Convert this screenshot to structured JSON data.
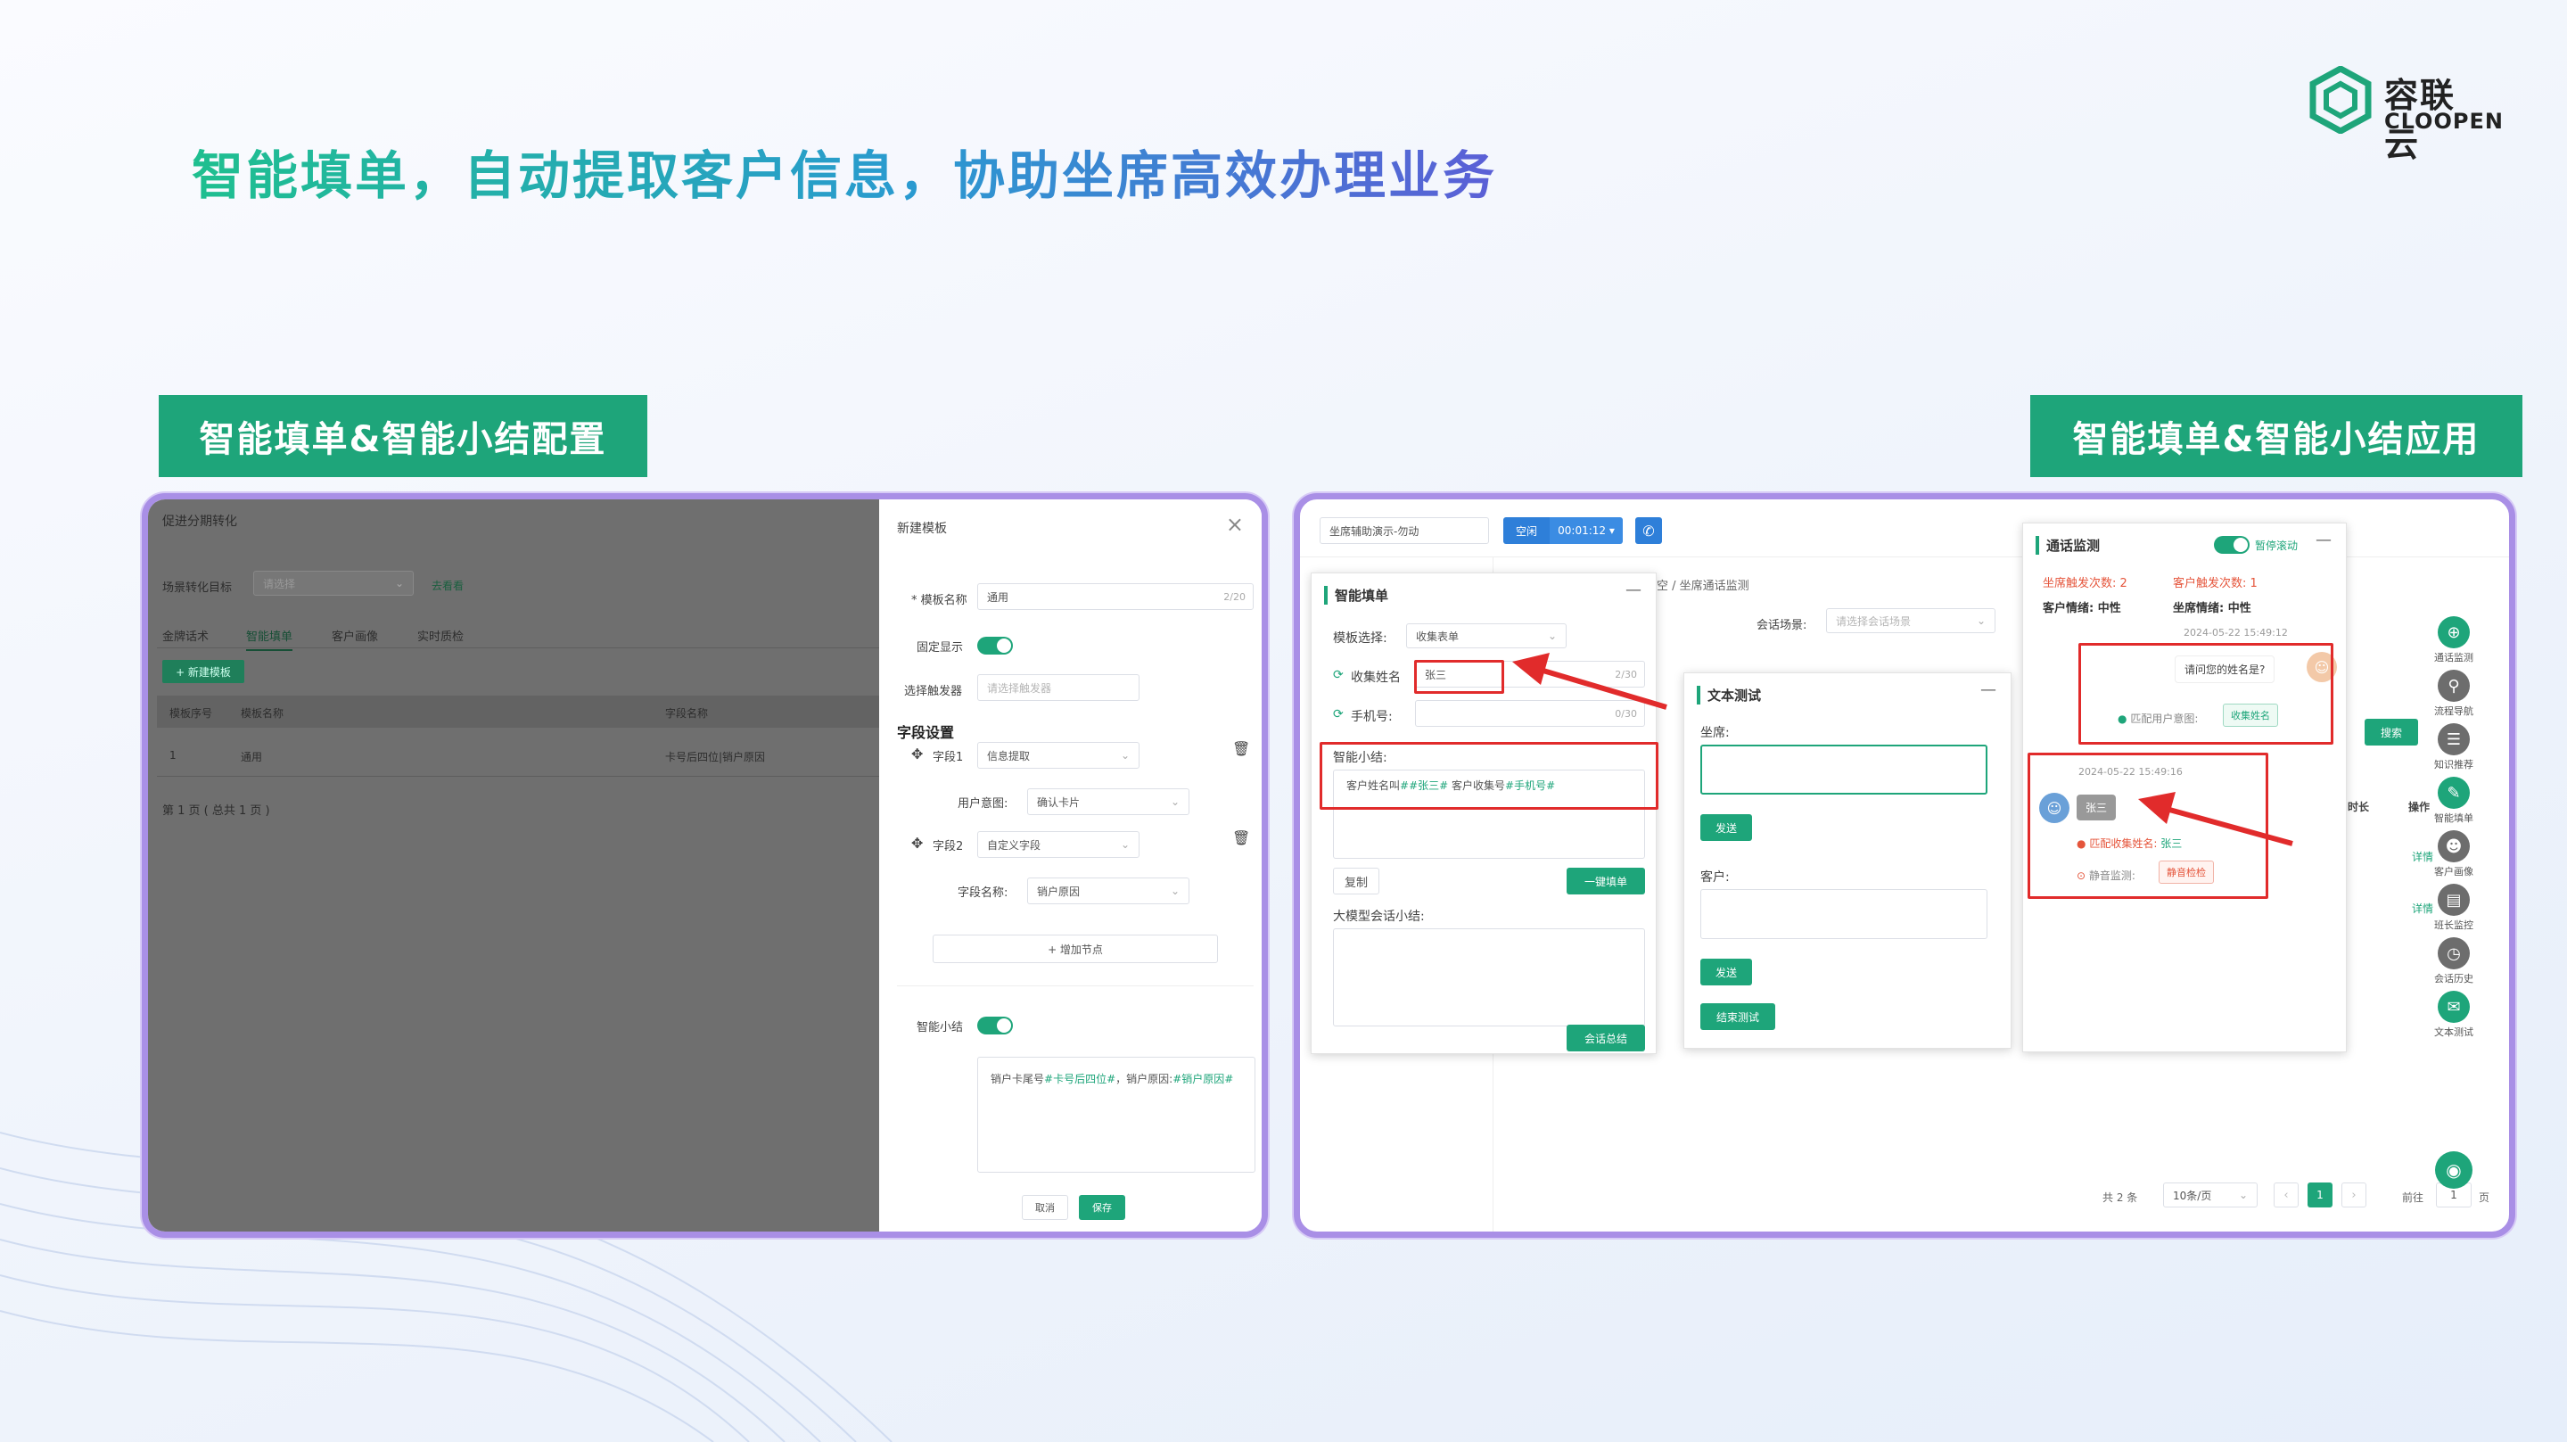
{
  "logo": {
    "cn": "容联云",
    "en": "CLOOPEN"
  },
  "title": "智能填单，自动提取客户信息，协助坐席高效办理业务",
  "tags": {
    "left": "智能填单&智能小结配置",
    "right": "智能填单&智能小结应用"
  },
  "left": {
    "bg": {
      "breadcrumb": "促进分期转化",
      "scene_label": "场景转化目标",
      "scene_placeholder": "请选择",
      "go_link": "去看看",
      "tabs": [
        "金牌话术",
        "智能填单",
        "客户画像",
        "实时质检"
      ],
      "new_btn": "+ 新建模板",
      "table_headers": [
        "模板序号",
        "模板名称",
        "字段名称"
      ],
      "row": [
        "1",
        "通用",
        "卡号后四位|销户原因"
      ],
      "pager": "第 1 页 ( 总共 1 页 )"
    },
    "drawer": {
      "title": "新建模板",
      "close": "×",
      "name_label": "* 模板名称",
      "name_value": "通用",
      "name_count": "2/20",
      "fixed_label": "固定显示",
      "trigger_label": "选择触发器",
      "trigger_placeholder": "请选择触发器",
      "section": "字段设置",
      "f1_label": "字段1",
      "f1_value": "信息提取",
      "intent_label": "用户意图:",
      "intent_value": "确认卡片",
      "f2_label": "字段2",
      "f2_value": "自定义字段",
      "fname_label": "字段名称:",
      "fname_value": "销户原因",
      "add_node": "+ 增加节点",
      "summary_label": "智能小结",
      "summary_text_a": "销户卡尾号",
      "summary_var1": "#卡号后四位#",
      "summary_text_b": "，销户原因:",
      "summary_var2": "#销户原因#",
      "cancel": "取消",
      "save": "保存"
    }
  },
  "right": {
    "topbar": {
      "select": "坐席辅助演示-勿动",
      "status": "空闲",
      "timer": "00:01:12 ▾",
      "crumb": "空 / 坐席通话监测",
      "session_label": "会话场景:",
      "session_ph": "请选择会话场景",
      "search": "搜索",
      "col_dur": "时长",
      "col_op": "操作",
      "detail1": "详情",
      "detail2": "详情",
      "pager_total": "共 2 条",
      "pager_size": "10条/页",
      "pager_page": "1",
      "pager_goto": "前往",
      "pager_goto_val": "1",
      "pager_unit": "页"
    },
    "fill": {
      "title": "智能填单",
      "min": "—",
      "tpl_label": "模板选择:",
      "tpl_value": "收集表单",
      "name_label": "收集姓名",
      "name_value": "张三",
      "name_count": "2/30",
      "phone_label": "手机号:",
      "phone_count": "0/30",
      "summary_label": "智能小结:",
      "summary_a": "客户姓名叫",
      "summary_v1": "##张三#",
      "summary_b": " 客户收集号",
      "summary_v2": "#手机号#",
      "copy": "复制",
      "one_click": "一键填单",
      "llm_label": "大模型会话小结:",
      "session_sum": "会话总结"
    },
    "test": {
      "title": "文本测试",
      "min": "—",
      "agent_label": "坐席:",
      "send1": "发送",
      "cust_label": "客户:",
      "send2": "发送",
      "end": "结束测试"
    },
    "monitor": {
      "title": "通话监测",
      "toggle_label": "暂停滚动",
      "min": "—",
      "agent_trig": "坐席触发次数: 2",
      "cust_trig": "客户触发次数: 1",
      "cust_mood": "客户情绪: 中性",
      "agent_mood": "坐席情绪: 中性",
      "ts1": "2024-05-22 15:49:12",
      "q": "请问您的姓名是?",
      "intent_label": "匹配用户意图:",
      "intent_tag": "收集姓名",
      "ts2": "2024-05-22 15:49:16",
      "bubble": "张三",
      "collect_label": "匹配收集姓名:",
      "collect_val": "张三",
      "silence_label": "静音监测:",
      "silence_tag": "静音检检"
    },
    "sidebar": [
      {
        "label": "通话监测",
        "icon": "monitor-icon"
      },
      {
        "label": "流程导航",
        "icon": "location-icon"
      },
      {
        "label": "知识推荐",
        "icon": "chat-icon"
      },
      {
        "label": "智能填单",
        "icon": "edit-icon"
      },
      {
        "label": "客户画像",
        "icon": "user-icon"
      },
      {
        "label": "班长监控",
        "icon": "chart-icon"
      },
      {
        "label": "会话历史",
        "icon": "clock-icon"
      },
      {
        "label": "文本测试",
        "icon": "message-icon"
      }
    ]
  }
}
